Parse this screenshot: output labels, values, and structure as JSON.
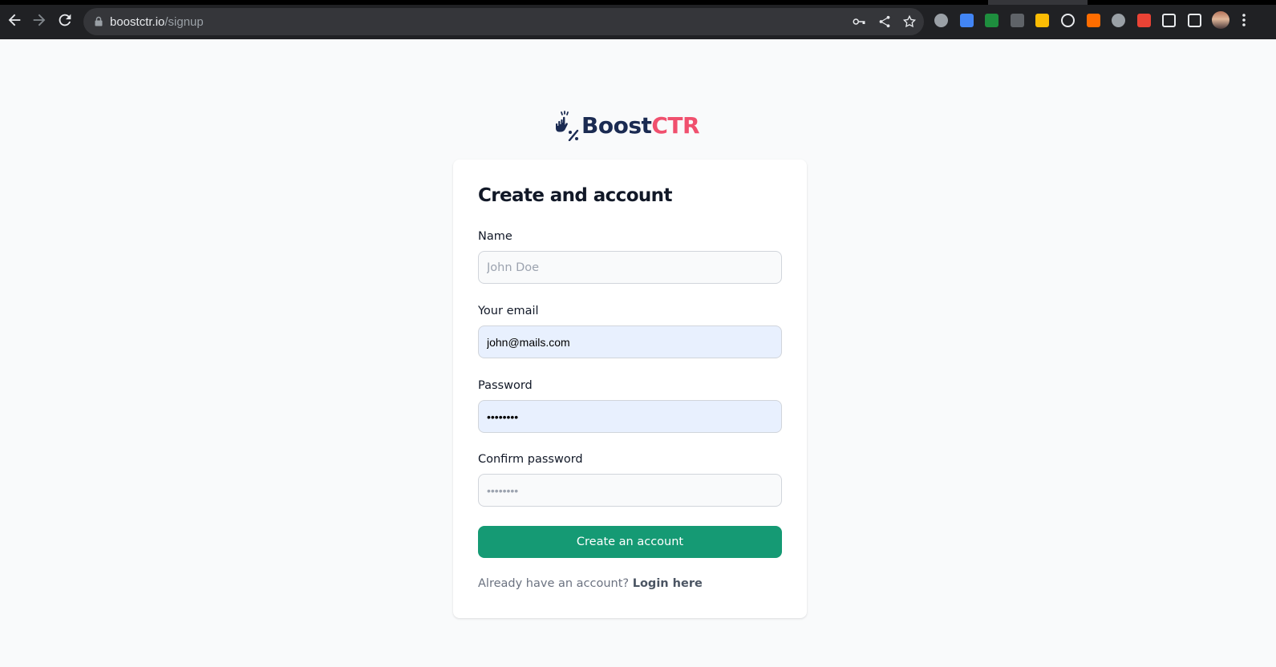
{
  "browser": {
    "url_host": "boostctr.io",
    "url_path": "/signup",
    "extensions": [
      {
        "name": "adblock-icon",
        "color": "#9aa0a6"
      },
      {
        "name": "docs-icon",
        "color": "#4285f4"
      },
      {
        "name": "mail-icon",
        "color": "#1e8e3e"
      },
      {
        "name": "brackets-icon",
        "color": "#5f6368"
      },
      {
        "name": "maps-icon",
        "color": "#fbbc04"
      },
      {
        "name": "atom-icon",
        "color": "#e8eaed"
      },
      {
        "name": "flame-icon",
        "color": "#ff6d00"
      },
      {
        "name": "shield-icon",
        "color": "#9aa0a6"
      },
      {
        "name": "glasses-icon",
        "color": "#ea4335"
      },
      {
        "name": "puzzle-icon",
        "color": "#e8eaed"
      },
      {
        "name": "sidepanel-icon",
        "color": "#e8eaed"
      }
    ]
  },
  "brand": {
    "name_part1": "Boost",
    "name_part2": "CTR",
    "primary_color": "#1b2b52",
    "accent_color": "#f0506e"
  },
  "form": {
    "title": "Create and account",
    "name": {
      "label": "Name",
      "placeholder": "John Doe",
      "value": ""
    },
    "email": {
      "label": "Your email",
      "placeholder": "",
      "value": "john@mails.com"
    },
    "password": {
      "label": "Password",
      "value": "••••••••"
    },
    "confirm_password": {
      "label": "Confirm password",
      "placeholder": "••••••••",
      "value": ""
    },
    "submit_label": "Create an account",
    "submit_color": "#159a74",
    "footer_text": "Already have an account?",
    "footer_link": "Login here"
  }
}
